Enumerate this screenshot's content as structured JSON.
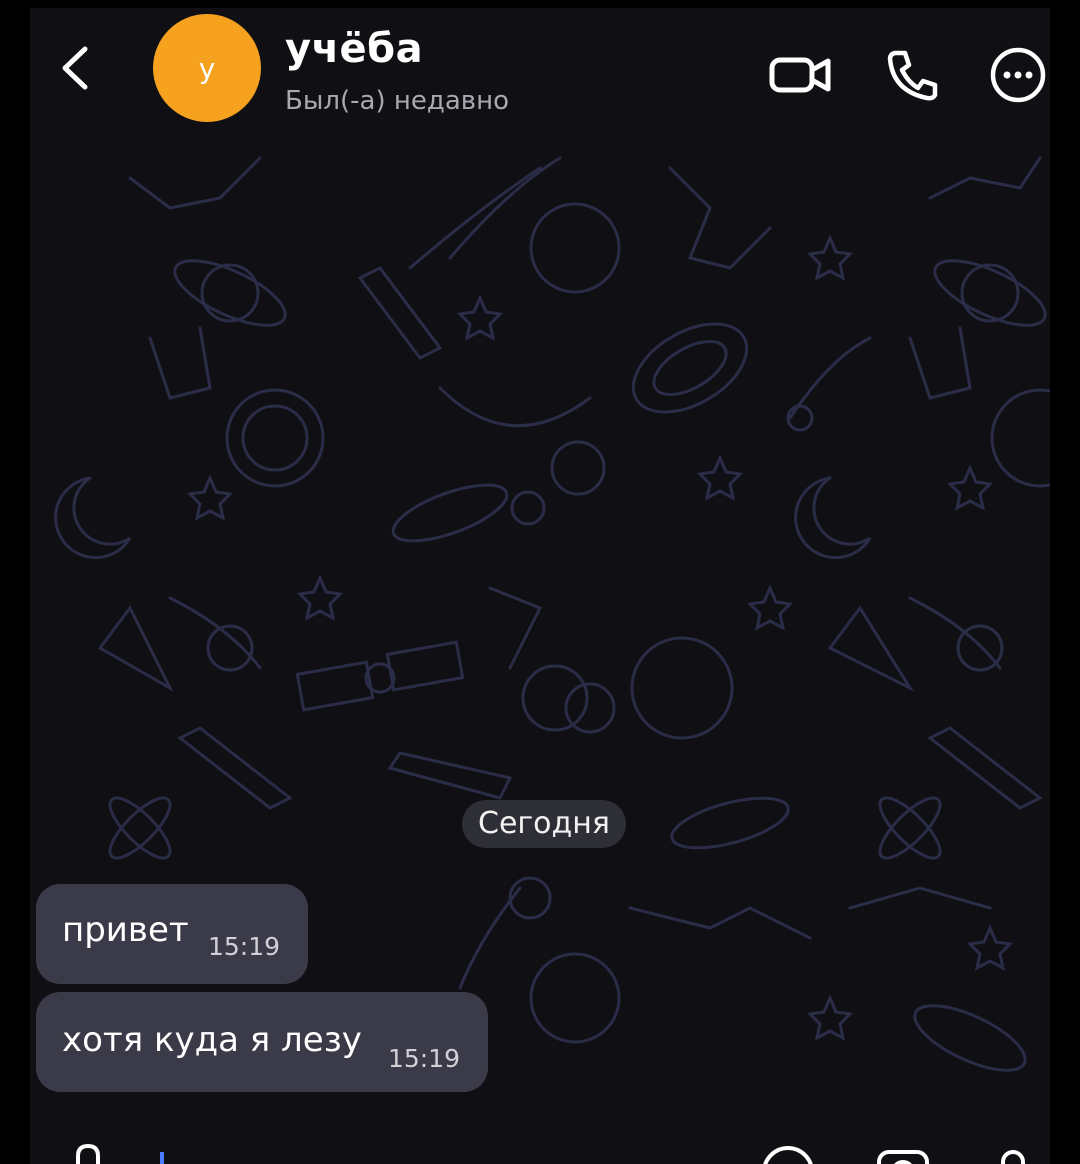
{
  "header": {
    "avatar_letter": "у",
    "title": "учёба",
    "status": "Был(-а) недавно"
  },
  "chat": {
    "date_separator": "Сегодня",
    "messages": [
      {
        "text": "привет",
        "time": "15:19"
      },
      {
        "text": "хотя куда я лезу",
        "time": "15:19"
      }
    ]
  },
  "colors": {
    "avatar": "#f7a21e",
    "background": "#0f0f14",
    "bubble": "#3a3a48",
    "doodle": "#2b2d48"
  },
  "icons": {
    "back": "chevron-left-icon",
    "video": "video-camera-icon",
    "call": "phone-icon",
    "more": "more-horizontal-icon",
    "attach": "paperclip-icon",
    "emoji": "smile-icon",
    "camera": "camera-icon",
    "mic": "microphone-icon"
  }
}
